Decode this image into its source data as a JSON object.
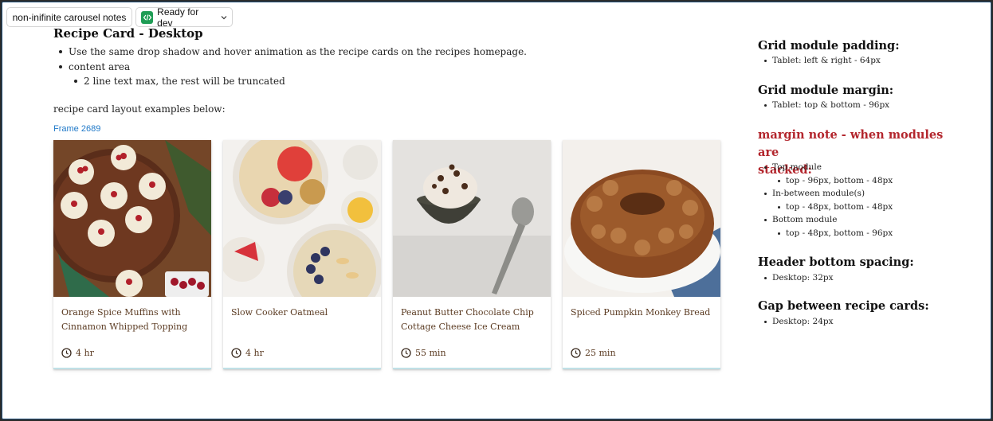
{
  "toolbar": {
    "notes_label": "non-inifinite carousel notes",
    "status_label": "Ready for dev"
  },
  "spec": {
    "title": "Recipe Card - Desktop",
    "bullets": [
      "Use the same drop shadow and hover animation as the recipe cards on the recipes homepage.",
      "content area",
      "2 line text max, the rest will be truncated"
    ],
    "examples_text": "recipe card layout examples below:",
    "frame_label": "Frame 2689"
  },
  "cards": [
    {
      "title_line1": "Orange Spice Muffins with",
      "title_line2": "Cinnamon Whipped Topping",
      "time": "4 hr",
      "image": "muffins-photo"
    },
    {
      "title_line1": "Slow Cooker Oatmeal",
      "title_line2": "",
      "time": "4 hr",
      "image": "oatmeal-photo"
    },
    {
      "title_line1": "Peanut Butter Chocolate Chip",
      "title_line2": "Cottage Cheese Ice Cream",
      "time": "55 min",
      "image": "ice-cream-photo"
    },
    {
      "title_line1": "Spiced Pumpkin Monkey Bread",
      "title_line2": "",
      "time": "25 min",
      "image": "monkey-bread-photo"
    }
  ],
  "notes": {
    "grid_padding_title": "Grid module padding:",
    "grid_padding_item": "Tablet: left & right - 64px",
    "grid_margin_title": "Grid module margin:",
    "grid_margin_item": "Tablet: top & bottom - 96px",
    "margin_note_line1": "margin note - when modules are",
    "margin_note_line2": "stacked:",
    "top_module": "Top module",
    "top_module_detail": "top - 96px, bottom - 48px",
    "between_module": "In-between module(s)",
    "between_module_detail": "top - 48px, bottom - 48px",
    "bottom_module": "Bottom module",
    "bottom_module_detail": "top - 48px, bottom - 96px",
    "header_spacing_title": "Header bottom spacing:",
    "header_spacing_item": "Desktop: 32px",
    "gap_title": "Gap between recipe cards:",
    "gap_item": "Desktop: 24px"
  },
  "colors": {
    "accent_red": "#b3262d",
    "link_blue": "#1e78c8",
    "card_text": "#5b3b22",
    "status_green": "#1f9d55"
  }
}
